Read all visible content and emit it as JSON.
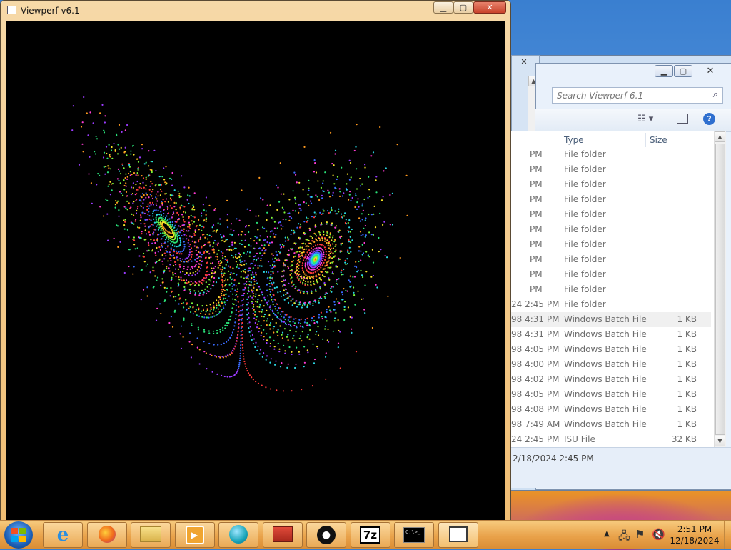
{
  "viewperf": {
    "title": "Viewperf v6.1"
  },
  "explorer": {
    "search_placeholder": "Search Viewperf 6.1",
    "columns": {
      "type": "Type",
      "size": "Size"
    },
    "rows": [
      {
        "date": "PM",
        "type": "File folder",
        "size": ""
      },
      {
        "date": "PM",
        "type": "File folder",
        "size": ""
      },
      {
        "date": "PM",
        "type": "File folder",
        "size": ""
      },
      {
        "date": "PM",
        "type": "File folder",
        "size": ""
      },
      {
        "date": "PM",
        "type": "File folder",
        "size": ""
      },
      {
        "date": "PM",
        "type": "File folder",
        "size": ""
      },
      {
        "date": "PM",
        "type": "File folder",
        "size": ""
      },
      {
        "date": "PM",
        "type": "File folder",
        "size": ""
      },
      {
        "date": "PM",
        "type": "File folder",
        "size": ""
      },
      {
        "date": "PM",
        "type": "File folder",
        "size": ""
      },
      {
        "date": "24 2:45 PM",
        "type": "File folder",
        "size": ""
      },
      {
        "date": "98 4:31 PM",
        "type": "Windows Batch File",
        "size": "1 KB"
      },
      {
        "date": "98 4:31 PM",
        "type": "Windows Batch File",
        "size": "1 KB"
      },
      {
        "date": "98 4:05 PM",
        "type": "Windows Batch File",
        "size": "1 KB"
      },
      {
        "date": "98 4:00 PM",
        "type": "Windows Batch File",
        "size": "1 KB"
      },
      {
        "date": "98 4:02 PM",
        "type": "Windows Batch File",
        "size": "1 KB"
      },
      {
        "date": "98 4:05 PM",
        "type": "Windows Batch File",
        "size": "1 KB"
      },
      {
        "date": "98 4:08 PM",
        "type": "Windows Batch File",
        "size": "1 KB"
      },
      {
        "date": "98 7:49 AM",
        "type": "Windows Batch File",
        "size": "1 KB"
      },
      {
        "date": "24 2:45 PM",
        "type": "ISU File",
        "size": "32 KB"
      }
    ],
    "details_date": "2/18/2024 2:45 PM"
  },
  "taskbar": {
    "apps": [
      {
        "name": "internet-explorer"
      },
      {
        "name": "firefox"
      },
      {
        "name": "file-explorer"
      },
      {
        "name": "media-player"
      },
      {
        "name": "media-app"
      },
      {
        "name": "toolbox"
      },
      {
        "name": "github"
      },
      {
        "name": "7zip",
        "label": "7z"
      },
      {
        "name": "command-prompt",
        "label": "C:\\>_"
      },
      {
        "name": "viewperf"
      }
    ],
    "time": "2:51 PM",
    "date": "12/18/2024"
  }
}
